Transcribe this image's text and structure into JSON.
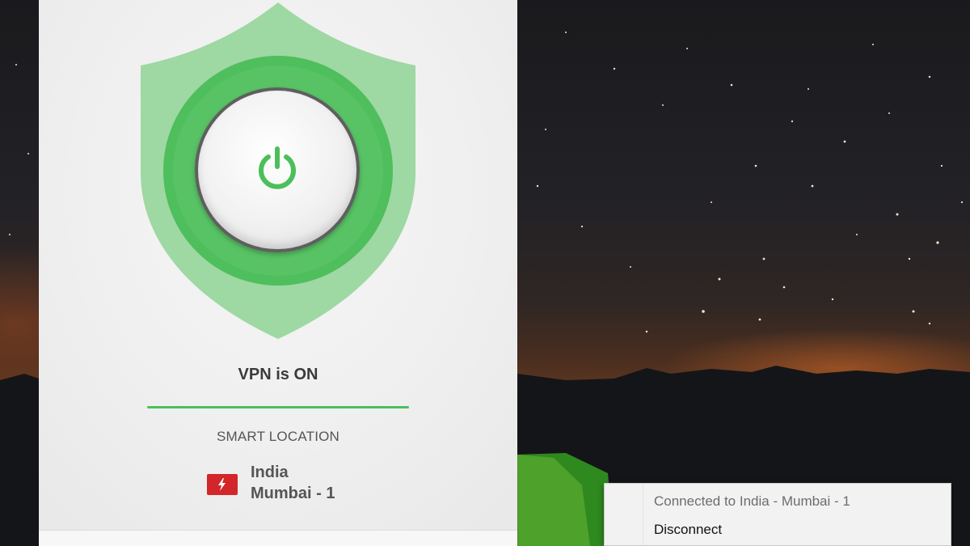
{
  "vpn_app": {
    "status_text": "VPN is ON",
    "location_heading": "SMART LOCATION",
    "location": {
      "country": "India",
      "city": "Mumbai - 1"
    },
    "power_button_icon": "power-icon",
    "flag_icon": "india-flag-icon",
    "colors": {
      "accent": "#4cbf5b",
      "shield_light": "#9ed8a3",
      "shield_ring": "#4fbe5c"
    }
  },
  "context_menu": {
    "status_item": "Connected to India - Mumbai - 1",
    "disconnect_item": "Disconnect"
  }
}
